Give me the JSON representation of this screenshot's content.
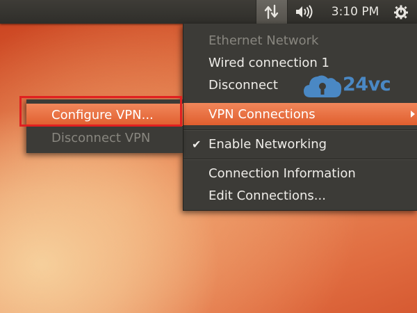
{
  "top_panel": {
    "network_icon": "network-transfer-icon",
    "sound_icon": "speaker-volume-icon",
    "clock": "3:10 PM",
    "session_icon": "gear-power-icon"
  },
  "network_menu": {
    "items": [
      {
        "label": "Ethernet Network",
        "disabled": true
      },
      {
        "label": "Wired connection 1"
      },
      {
        "label": "Disconnect"
      },
      {
        "label": "VPN Connections",
        "highlighted": true,
        "has_submenu": true
      },
      {
        "label": "Enable Networking",
        "checked": true
      },
      {
        "label": "Connection Information"
      },
      {
        "label": "Edit Connections..."
      }
    ]
  },
  "vpn_submenu": {
    "items": [
      {
        "label": "Configure VPN...",
        "highlighted": true
      },
      {
        "label": "Disconnect VPN",
        "disabled": true
      }
    ]
  },
  "watermark": {
    "text": "24vc",
    "icon": "cloud-lock-icon"
  },
  "colors": {
    "highlight": "#e8703f",
    "menu_bg": "#3c3b37",
    "panel_bg": "#3a3935",
    "outline": "#e02020",
    "watermark": "#4a88c4"
  }
}
